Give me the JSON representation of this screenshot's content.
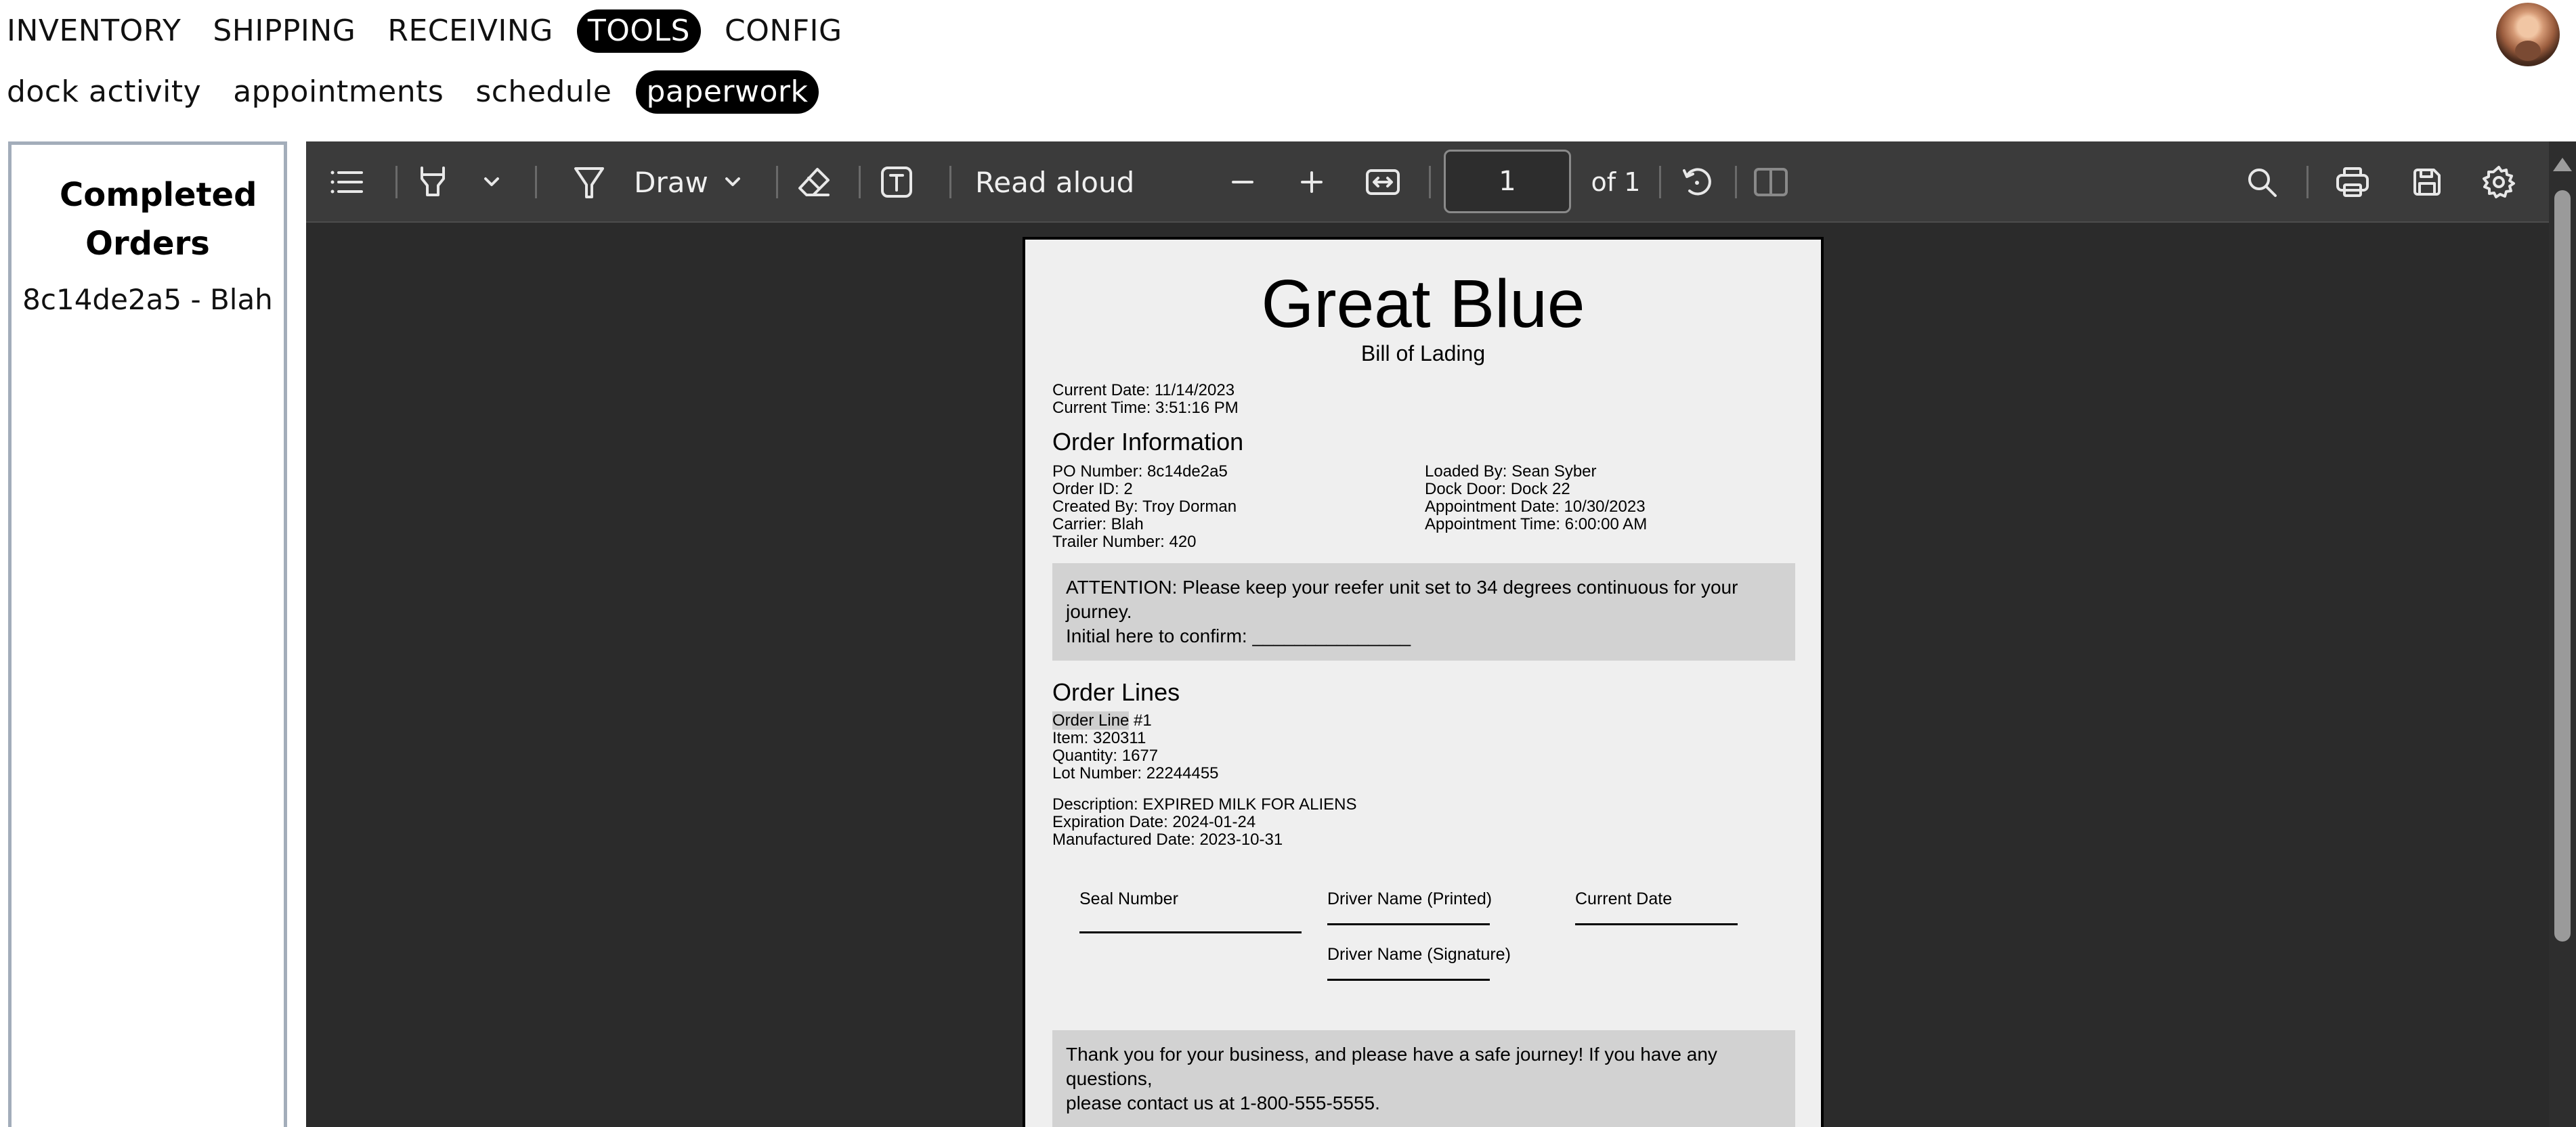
{
  "nav": {
    "primary": [
      "INVENTORY",
      "SHIPPING",
      "RECEIVING",
      "TOOLS",
      "CONFIG"
    ],
    "primary_active": "TOOLS",
    "secondary": [
      "dock activity",
      "appointments",
      "schedule",
      "paperwork"
    ],
    "secondary_active": "paperwork"
  },
  "sidebar": {
    "title": "Completed Orders",
    "items": [
      "8c14de2a5 - Blah"
    ]
  },
  "toolbar": {
    "draw_label": "Draw",
    "read_aloud_label": "Read aloud",
    "page_number": "1",
    "page_total": "of 1"
  },
  "document": {
    "company": "Great Blue",
    "doc_type": "Bill of Lading",
    "current_date": "Current Date: 11/14/2023",
    "current_time": "Current Time: 3:51:16 PM",
    "order_info_heading": "Order Information",
    "order_info_left": [
      "PO Number: 8c14de2a5",
      "Order ID: 2",
      "Created By: Troy Dorman",
      "Carrier: Blah",
      "Trailer Number: 420"
    ],
    "order_info_right": [
      "Loaded By: Sean Syber",
      "Dock Door: Dock 22",
      "Appointment Date: 10/30/2023",
      "Appointment Time: 6:00:00 AM"
    ],
    "attention_line1": "ATTENTION: Please keep your reefer unit set to 34 degrees continuous for your journey.",
    "attention_line2": "Initial here to confirm: _______________",
    "order_lines_heading": "Order Lines",
    "order_line_label": "Order Line",
    "order_line_number": " #1",
    "order_line_details": [
      "Item: 320311",
      "Quantity: 1677",
      "Lot Number: 22244455"
    ],
    "order_line_more": [
      "Description: EXPIRED MILK FOR ALIENS",
      "Expiration Date: 2024-01-24",
      "Manufactured Date: 2023-10-31"
    ],
    "seal_number_label": "Seal Number",
    "driver_printed_label": "Driver Name (Printed)",
    "current_date_label": "Current Date",
    "driver_signature_label": "Driver Name (Signature)",
    "thank_you_line1": "Thank you for your business, and please have a safe journey! If you have any questions,",
    "thank_you_line2": "please contact us at 1-800-555-5555."
  }
}
